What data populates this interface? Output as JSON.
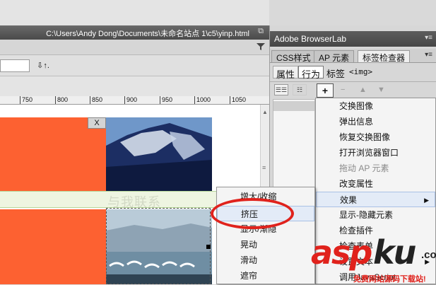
{
  "window": {
    "title_path": "C:\\Users\\Andy Dong\\Documents\\未命名站点 1\\c5\\yinp.html",
    "restore_glyph": "⧉"
  },
  "toolbar": {
    "sort_label": "⇩↑."
  },
  "ruler": {
    "labels": [
      "750",
      "800",
      "850",
      "900",
      "950",
      "1000",
      "1050"
    ]
  },
  "canvas": {
    "close_label": "X",
    "contact_text": "与我联系"
  },
  "panel": {
    "header_title": "Adobe BrowserLab",
    "menu_glyph": "▾≡",
    "tabs": [
      "CSS样式",
      "AP 元素",
      "标签检查器"
    ],
    "sub_tabs": [
      "属性",
      "行为"
    ],
    "tag_label": "标签",
    "tag_value": "<img>",
    "add_label": "+",
    "minus_label": "−",
    "up_label": "▲",
    "down_label": "▼"
  },
  "menu_main": {
    "items": [
      {
        "label": "交换图像",
        "disabled": false,
        "submenu": false
      },
      {
        "label": "弹出信息",
        "disabled": false,
        "submenu": false
      },
      {
        "label": "恢复交换图像",
        "disabled": false,
        "submenu": false
      },
      {
        "label": "打开浏览器窗口",
        "disabled": false,
        "submenu": false
      },
      {
        "label": "拖动 AP 元素",
        "disabled": true,
        "submenu": false
      },
      {
        "label": "改变属性",
        "disabled": false,
        "submenu": false
      },
      {
        "label": "效果",
        "disabled": false,
        "submenu": true,
        "hover": true
      },
      {
        "label": "显示-隐藏元素",
        "disabled": false,
        "submenu": false
      },
      {
        "label": "检查插件",
        "disabled": false,
        "submenu": false
      },
      {
        "label": "检查表单",
        "disabled": false,
        "submenu": false
      },
      {
        "label": "设置文本",
        "disabled": false,
        "submenu": true
      },
      {
        "label": "调用JavaScript",
        "disabled": false,
        "submenu": false
      }
    ]
  },
  "menu_sub": {
    "items": [
      {
        "label": "增大/收缩"
      },
      {
        "label": "挤压",
        "hover": true
      },
      {
        "label": "显示/渐隐"
      },
      {
        "label": "晃动"
      },
      {
        "label": "滑动"
      },
      {
        "label": "遮帘"
      }
    ]
  },
  "watermark": {
    "asp": "asp",
    "ku": "ku",
    "com": ".com",
    "sub": "免费网站源码下载站!"
  },
  "colors": {
    "accent_red": "#e0221c",
    "orange_block": "#fd6131"
  }
}
